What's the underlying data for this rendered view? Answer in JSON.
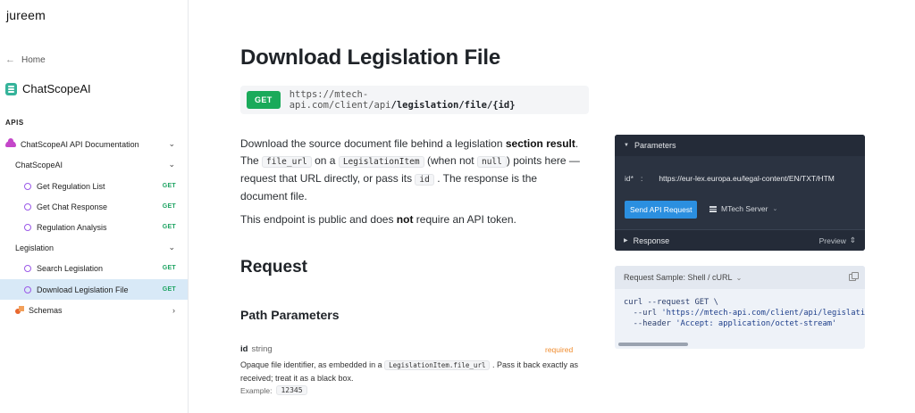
{
  "sidebar": {
    "brand": "jureem",
    "home": "Home",
    "project": "ChatScopeAI",
    "section_label": "APIS",
    "api_doc": "ChatScopeAI API Documentation",
    "groups": [
      {
        "label": "ChatScopeAI",
        "items": [
          {
            "label": "Get Regulation List",
            "method": "GET"
          },
          {
            "label": "Get Chat Response",
            "method": "GET"
          },
          {
            "label": "Regulation Analysis",
            "method": "GET"
          }
        ]
      },
      {
        "label": "Legislation",
        "items": [
          {
            "label": "Search Legislation",
            "method": "GET"
          },
          {
            "label": "Download Legislation File",
            "method": "GET"
          }
        ]
      }
    ],
    "schemas": "Schemas"
  },
  "main": {
    "title": "Download Legislation File",
    "method": "GET",
    "url_base": "https://mtech-api.com/client/api",
    "url_path": "/legislation/file/{id}",
    "desc": {
      "p1_a": "Download the source document file behind a legislation ",
      "p1_b": "section result",
      "p1_c": ". The ",
      "code_file_url": "file_url",
      "p1_d": " on a ",
      "code_item": "LegislationItem",
      "p1_e": " (when not ",
      "code_null": "null",
      "p1_f": ") points here — request that URL directly, or pass its ",
      "code_id": "id",
      "p1_g": " . The response is the document file.",
      "p2_a": "This endpoint is public and does ",
      "p2_b": "not",
      "p2_c": " require an API token."
    },
    "request_heading": "Request",
    "path_params_heading": "Path Parameters",
    "param": {
      "name": "id",
      "type": "string",
      "required": "required",
      "desc_a": "Opaque file identifier, as embedded in a ",
      "desc_code": "LegislationItem.file_url",
      "desc_b": " . Pass it back exactly as received; treat it as a black box.",
      "example_label": "Example:",
      "example_value": "12345"
    }
  },
  "try_panel": {
    "parameters_label": "Parameters",
    "param_name": "id*",
    "param_sep": ":",
    "param_value": "https://eur-lex.europa.eu/legal-content/EN/TXT/HTM",
    "send_button": "Send API Request",
    "server": "MTech Server",
    "response_label": "Response",
    "preview_label": "Preview"
  },
  "sample": {
    "title": "Request Sample: Shell / cURL",
    "line1": "curl --request GET \\",
    "line2_a": "  --url ",
    "line2_b": "'https://mtech-api.com/client/api/legislatio",
    "line3_a": "  --header ",
    "line3_b": "'Accept: application/octet-stream'"
  }
}
